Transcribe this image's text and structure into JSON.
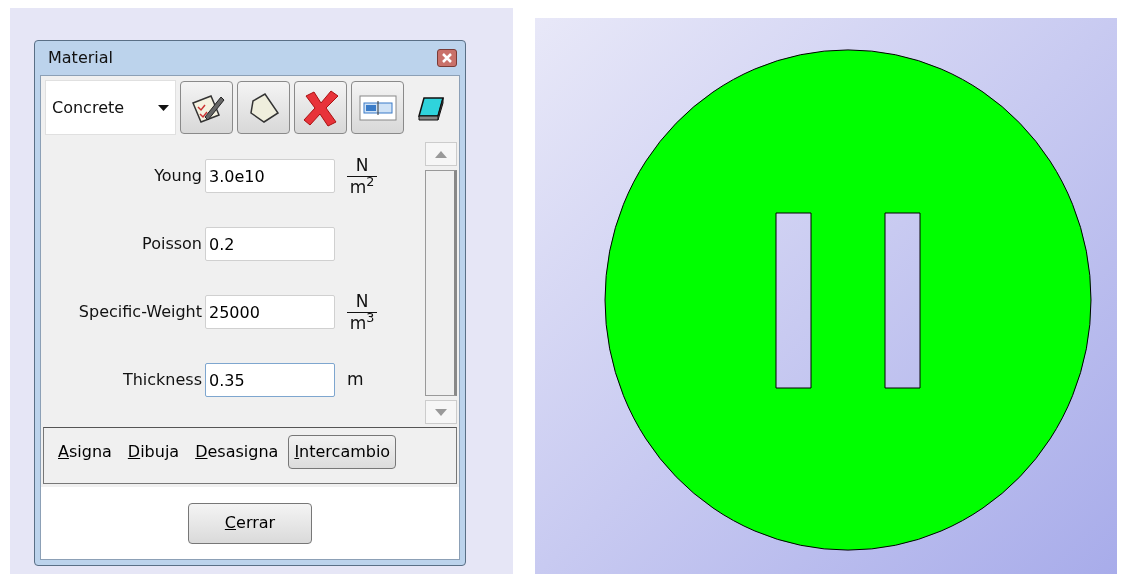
{
  "window": {
    "title": "Material"
  },
  "toolbar": {
    "material": "Concrete",
    "buttons": [
      {
        "kind": "edit"
      },
      {
        "kind": "new"
      },
      {
        "kind": "delete"
      },
      {
        "kind": "rename"
      }
    ],
    "extra": {
      "kind": "eraser"
    }
  },
  "properties": [
    {
      "label": "Young",
      "value": "3.0e10",
      "kind": "fraction",
      "numerator": "N",
      "denominator": "m",
      "exponent": "2"
    },
    {
      "label": "Poisson",
      "value": "0.2",
      "kind": "none"
    },
    {
      "label": "Specific-Weight",
      "value": "25000",
      "kind": "fraction",
      "numerator": "N",
      "denominator": "m",
      "exponent": "3"
    },
    {
      "label": "Thickness",
      "value": "0.35",
      "kind": "plain",
      "unit": "m",
      "focused": true
    }
  ],
  "mode_buttons": [
    {
      "label": "Asigna",
      "selected": false
    },
    {
      "label": "Dibuja",
      "selected": false
    },
    {
      "label": "Desasigna",
      "selected": false
    },
    {
      "label": "Intercambio",
      "selected": true
    }
  ],
  "close_button": "Cerrar"
}
